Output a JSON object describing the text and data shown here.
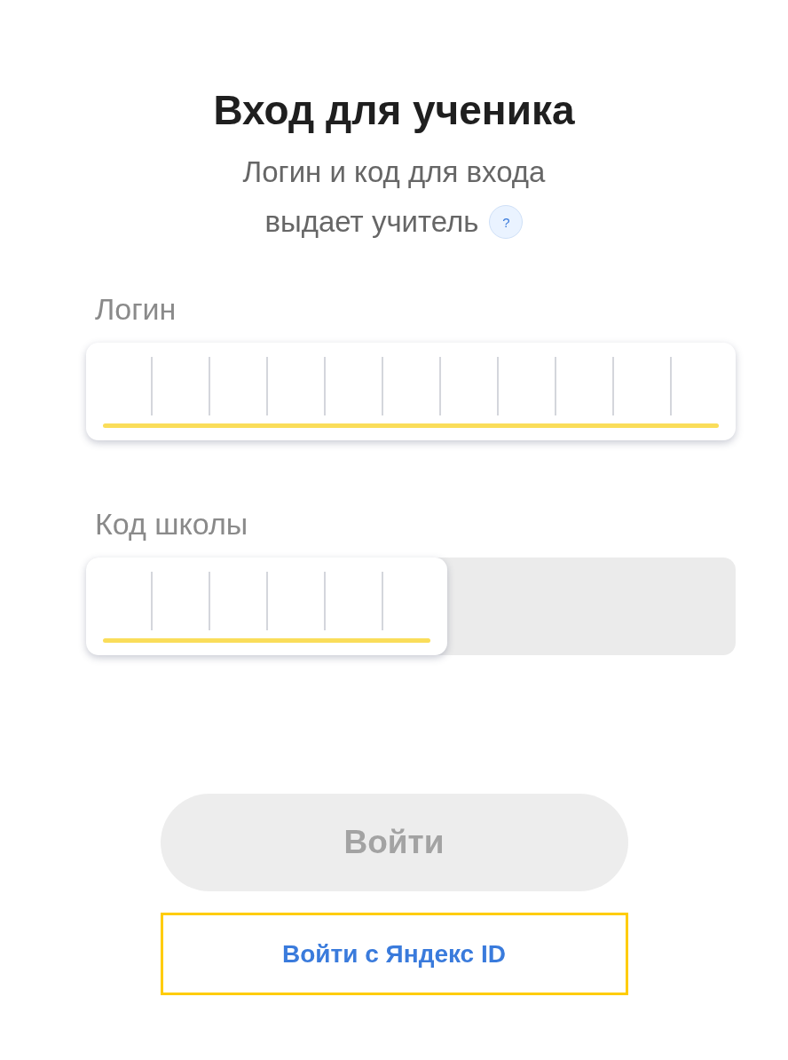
{
  "title": "Вход для ученика",
  "subtitle": {
    "lines": [
      "Логин и код для входа",
      "выдает учитель"
    ],
    "help_icon": "?"
  },
  "fields": [
    {
      "kind": "login",
      "label": "Логин",
      "focused": false
    },
    {
      "kind": "school_code",
      "label": "Код школы",
      "focused": false
    }
  ],
  "submit_button": {
    "label": "Войти",
    "disabled": true
  },
  "yandex_link": {
    "label": "Войти с Яндекс ID",
    "focused": true
  }
}
